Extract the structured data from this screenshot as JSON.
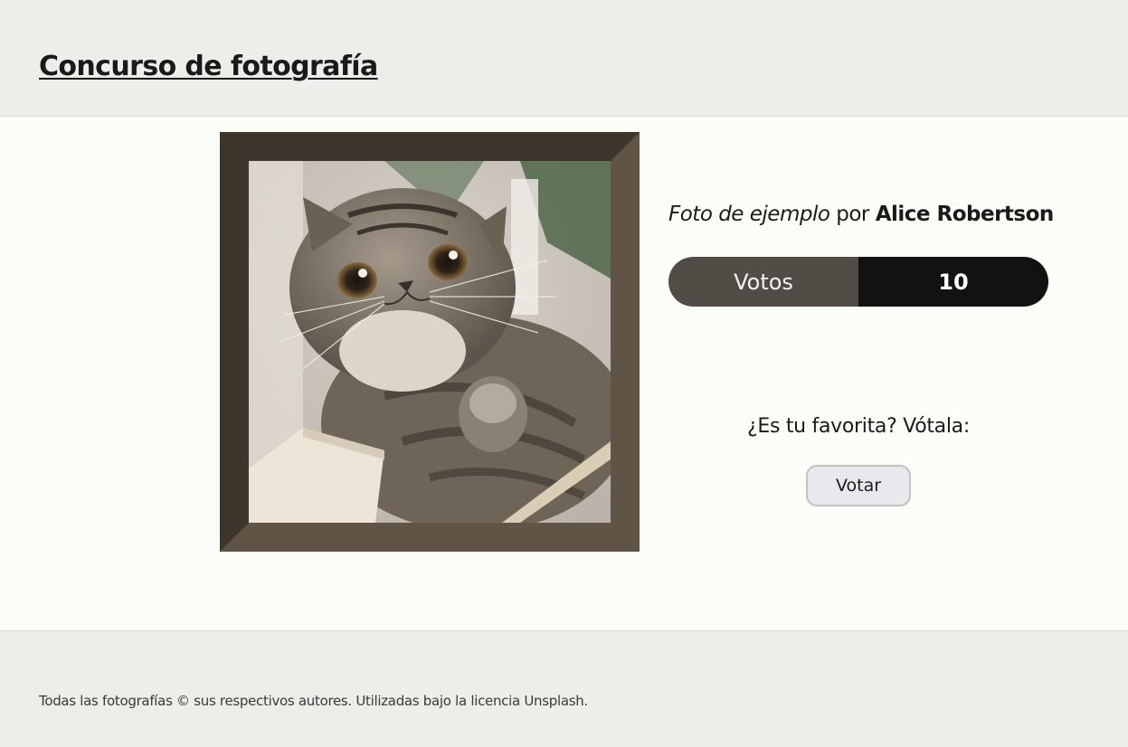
{
  "header": {
    "title": "Concurso de fotografía"
  },
  "photo": {
    "alt": "Foto de ejemplo",
    "frame_colors": {
      "dark": "#3e362d",
      "light": "#5f5446"
    }
  },
  "entry": {
    "title": "Foto de ejemplo",
    "by": "por",
    "author": "Alice Robertson"
  },
  "votes": {
    "label": "Votos",
    "count": "10"
  },
  "vote": {
    "prompt": "¿Es tu favorita? Vótala:",
    "button_label": "Votar"
  },
  "footer": {
    "text": "Todas las fotografías © sus respectivos autores. Utilizadas bajo la licencia Unsplash."
  }
}
